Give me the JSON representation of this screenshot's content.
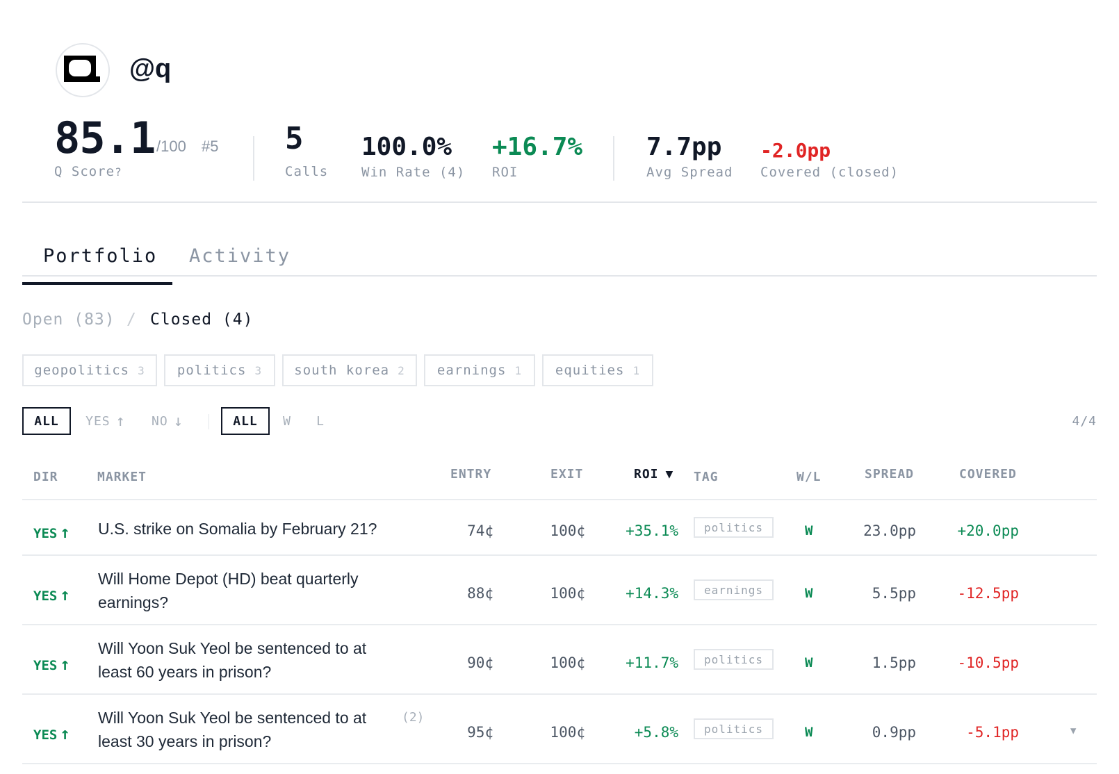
{
  "profile": {
    "handle": "@q",
    "avatar_icon": "q-logo-icon"
  },
  "stats": {
    "score": "85.1",
    "score_max": "/100",
    "rank": "#5",
    "score_label": "Q Score",
    "calls": "5",
    "calls_label": "Calls",
    "win_rate": "100.0%",
    "win_rate_label": "Win Rate (4)",
    "roi": "+16.7%",
    "roi_label": "ROI",
    "avg_spread": "7.7pp",
    "avg_spread_label": "Avg Spread",
    "covered": "-2.0pp",
    "covered_label": "Covered (closed)"
  },
  "colors": {
    "green": "#0b8a54",
    "red": "#e02424",
    "ink": "#111827",
    "grey": "#8b95a3"
  },
  "tabs": [
    {
      "label": "Portfolio",
      "active": true
    },
    {
      "label": "Activity",
      "active": false
    }
  ],
  "subtabs": {
    "open": "Open (83)",
    "separator": "/",
    "closed": "Closed (4)"
  },
  "chips": [
    {
      "label": "geopolitics",
      "count": "3"
    },
    {
      "label": "politics",
      "count": "3"
    },
    {
      "label": "south korea",
      "count": "2"
    },
    {
      "label": "earnings",
      "count": "1"
    },
    {
      "label": "equities",
      "count": "1"
    }
  ],
  "filters": {
    "dir_all": "ALL",
    "dir_yes": "YES",
    "dir_no": "NO",
    "result_all": "ALL",
    "result_w": "W",
    "result_l": "L",
    "count": "4/4"
  },
  "columns": {
    "dir": "DIR",
    "market": "MARKET",
    "entry": "ENTRY",
    "exit": "EXIT",
    "roi": "ROI",
    "sort_indicator": "▼",
    "tag": "TAG",
    "wl": "W/L",
    "spread": "SPREAD",
    "covered": "COVERED"
  },
  "rows": [
    {
      "dir": "YES",
      "market": "U.S. strike on Somalia by February 21?",
      "count": "",
      "entry": "74¢",
      "exit": "100¢",
      "roi": "+35.1%",
      "tag": "politics",
      "wl": "W",
      "spread": "23.0pp",
      "covered": "+20.0pp",
      "covered_positive": true
    },
    {
      "dir": "YES",
      "market": "Will Home Depot (HD) beat quarterly earnings?",
      "count": "",
      "entry": "88¢",
      "exit": "100¢",
      "roi": "+14.3%",
      "tag": "earnings",
      "wl": "W",
      "spread": "5.5pp",
      "covered": "-12.5pp",
      "covered_positive": false
    },
    {
      "dir": "YES",
      "market": "Will Yoon Suk Yeol be sentenced to at least 60 years in prison?",
      "count": "",
      "entry": "90¢",
      "exit": "100¢",
      "roi": "+11.7%",
      "tag": "politics",
      "wl": "W",
      "spread": "1.5pp",
      "covered": "-10.5pp",
      "covered_positive": false
    },
    {
      "dir": "YES",
      "market": "Will Yoon Suk Yeol be sentenced to at least 30 years in prison?",
      "count": "(2)",
      "entry": "95¢",
      "exit": "100¢",
      "roi": "+5.8%",
      "tag": "politics",
      "wl": "W",
      "spread": "0.9pp",
      "covered": "-5.1pp",
      "covered_positive": false,
      "expand": "▼"
    }
  ]
}
